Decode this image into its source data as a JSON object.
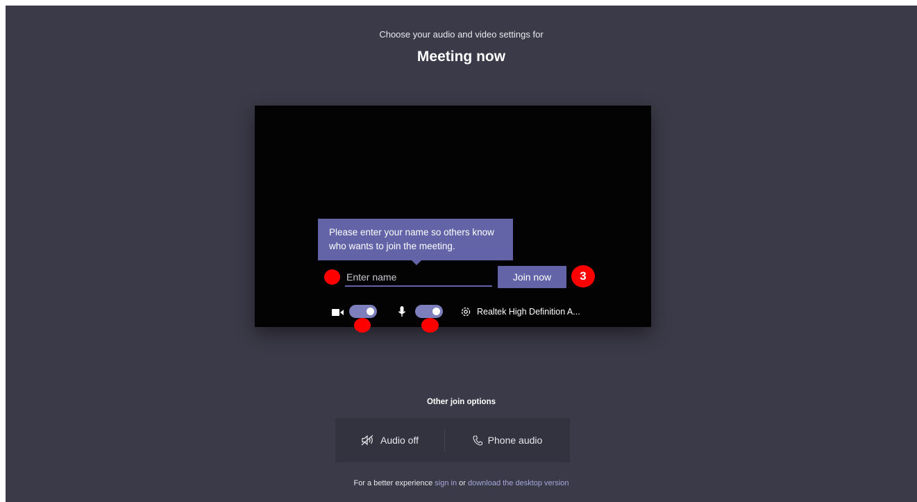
{
  "header": {
    "subtitle": "Choose your audio and video settings for",
    "title": "Meeting now"
  },
  "prejoin": {
    "tooltip_text": "Please enter your name so others know who wants to join the meeting.",
    "name_placeholder": "Enter name",
    "name_value": "",
    "join_label": "Join now",
    "device_label": "Realtek High Definition A...",
    "camera_on": true,
    "mic_on": true
  },
  "annotations": {
    "step_number": "3",
    "marker_color": "#ff0000"
  },
  "other_options": {
    "title": "Other join options",
    "audio_off_label": "Audio off",
    "phone_audio_label": "Phone audio"
  },
  "footer": {
    "prefix": "For a better experience",
    "sign_in": "sign in",
    "or": "or",
    "download": "download the desktop version"
  },
  "colors": {
    "background": "#3b3a48",
    "accent": "#6264a7",
    "toggle": "#7d7fbd",
    "link": "#a6a7dc"
  },
  "icons": [
    "camera-icon",
    "microphone-icon",
    "settings-icon",
    "speaker-off-icon",
    "phone-icon"
  ]
}
